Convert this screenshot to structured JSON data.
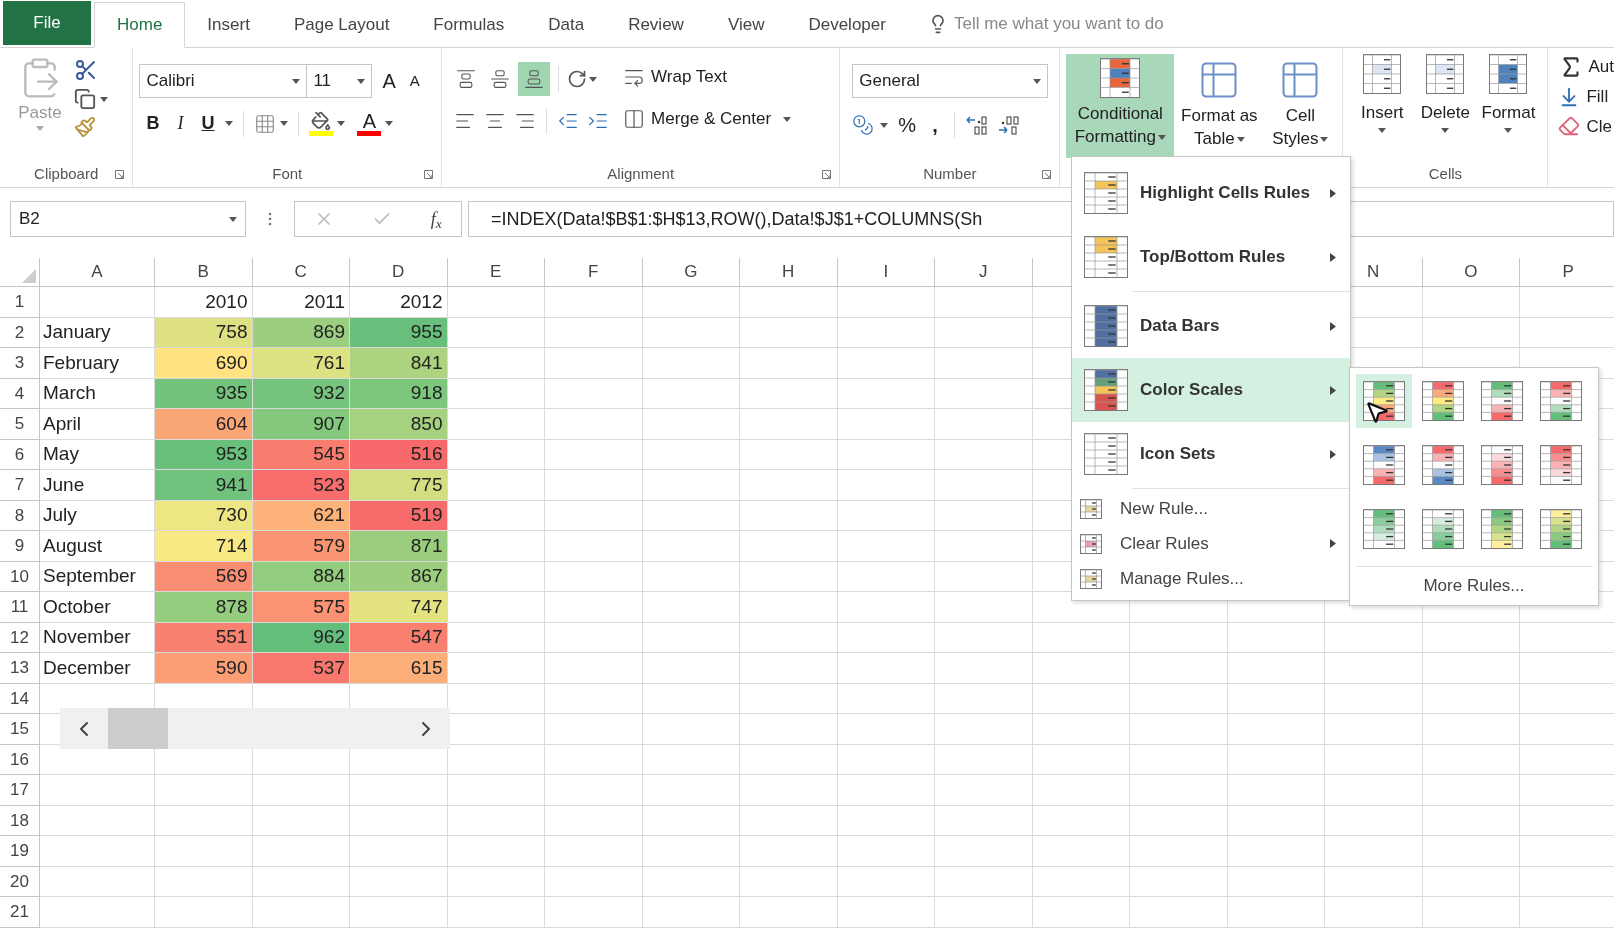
{
  "tabs": [
    {
      "label": "File",
      "kind": "file",
      "selected": false
    },
    {
      "label": "Home",
      "kind": "tab",
      "selected": true
    },
    {
      "label": "Insert",
      "kind": "tab",
      "selected": false
    },
    {
      "label": "Page Layout",
      "kind": "tab",
      "selected": false
    },
    {
      "label": "Formulas",
      "kind": "tab",
      "selected": false
    },
    {
      "label": "Data",
      "kind": "tab",
      "selected": false
    },
    {
      "label": "Review",
      "kind": "tab",
      "selected": false
    },
    {
      "label": "View",
      "kind": "tab",
      "selected": false
    },
    {
      "label": "Developer",
      "kind": "tab",
      "selected": false
    }
  ],
  "tell_me": {
    "placeholder": "Tell me what you want to do"
  },
  "ribbon": {
    "clipboard": {
      "paste": "Paste",
      "label": "Clipboard"
    },
    "font": {
      "name": "Calibri",
      "size": "11",
      "grow": "A",
      "shrink": "A",
      "bold": "B",
      "italic": "I",
      "underline": "U",
      "color_letter": "A",
      "label": "Font"
    },
    "alignment": {
      "vertical": [
        {
          "selected": false
        },
        {
          "selected": false
        },
        {
          "selected": true
        }
      ],
      "wrap": "Wrap Text",
      "merge": "Merge & Center",
      "label": "Alignment"
    },
    "number": {
      "format": "General",
      "percent": "%",
      "comma": ",",
      "label": "Number"
    },
    "styles": {
      "conditional": {
        "label": "Conditional Formatting",
        "expanded": true
      },
      "table": "Format as Table",
      "cell": "Cell Styles"
    },
    "cells": {
      "insert": "Insert",
      "delete": "Delete",
      "format": "Format",
      "label": "Cells"
    },
    "editing": {
      "autosum": "Aut",
      "fill": "Fill",
      "clear": "Cle"
    }
  },
  "formula_bar": {
    "name_box": "B2",
    "fx": "f$_{x}$",
    "formula": "=INDEX(Data!$B$1:$H$13,ROW(),Data!$J$1+COLUMNS(Sh"
  },
  "column_headers_left": [
    "A",
    "B",
    "C",
    "D",
    "E",
    "F",
    "G",
    "H",
    "I",
    "J"
  ],
  "column_headers_right": [
    "N",
    "O",
    "P"
  ],
  "row_numbers": [
    "1",
    "2",
    "3",
    "4",
    "5",
    "6",
    "7",
    "8",
    "9",
    "10",
    "11",
    "12",
    "13",
    "14",
    "15",
    "16",
    "17",
    "18",
    "19",
    "20",
    "21"
  ],
  "header_row": [
    "2010",
    "2011",
    "2012"
  ],
  "rows": [
    {
      "month": "January",
      "cells": [
        {
          "value": "758",
          "color": "#dde182"
        },
        {
          "value": "869",
          "color": "#9bce7e"
        },
        {
          "value": "955",
          "color": "#67bf7b"
        }
      ]
    },
    {
      "month": "February",
      "cells": [
        {
          "value": "690",
          "color": "#ffe382"
        },
        {
          "value": "761",
          "color": "#dce182"
        },
        {
          "value": "841",
          "color": "#acd37f"
        }
      ]
    },
    {
      "month": "March",
      "cells": [
        {
          "value": "935",
          "color": "#73c37c"
        },
        {
          "value": "932",
          "color": "#75c37c"
        },
        {
          "value": "918",
          "color": "#7dc67d"
        }
      ]
    },
    {
      "month": "April",
      "cells": [
        {
          "value": "604",
          "color": "#fba677"
        },
        {
          "value": "907",
          "color": "#84c87d"
        },
        {
          "value": "850",
          "color": "#a6d17f"
        }
      ]
    },
    {
      "month": "May",
      "cells": [
        {
          "value": "953",
          "color": "#68c07b"
        },
        {
          "value": "545",
          "color": "#f97d6f"
        },
        {
          "value": "516",
          "color": "#f8696b"
        }
      ]
    },
    {
      "month": "June",
      "cells": [
        {
          "value": "941",
          "color": "#70c27c"
        },
        {
          "value": "523",
          "color": "#f86e6c"
        },
        {
          "value": "775",
          "color": "#d3de81"
        }
      ]
    },
    {
      "month": "July",
      "cells": [
        {
          "value": "730",
          "color": "#eee683"
        },
        {
          "value": "621",
          "color": "#fcb279"
        },
        {
          "value": "519",
          "color": "#f86b6b"
        }
      ]
    },
    {
      "month": "August",
      "cells": [
        {
          "value": "714",
          "color": "#f8e984"
        },
        {
          "value": "579",
          "color": "#fa9573"
        },
        {
          "value": "871",
          "color": "#9ace7e"
        }
      ]
    },
    {
      "month": "September",
      "cells": [
        {
          "value": "569",
          "color": "#fa8e72"
        },
        {
          "value": "884",
          "color": "#92cc7e"
        },
        {
          "value": "867",
          "color": "#9cce7e"
        }
      ]
    },
    {
      "month": "October",
      "cells": [
        {
          "value": "878",
          "color": "#95cd7e"
        },
        {
          "value": "575",
          "color": "#fa9273"
        },
        {
          "value": "747",
          "color": "#e4e382"
        }
      ]
    },
    {
      "month": "November",
      "cells": [
        {
          "value": "551",
          "color": "#f98170"
        },
        {
          "value": "962",
          "color": "#63be7b"
        },
        {
          "value": "547",
          "color": "#f97f6f"
        }
      ]
    },
    {
      "month": "December",
      "cells": [
        {
          "value": "590",
          "color": "#fb9d75"
        },
        {
          "value": "537",
          "color": "#f9786e"
        },
        {
          "value": "615",
          "color": "#fcae78"
        }
      ]
    }
  ],
  "cf_menu": {
    "items": [
      {
        "kind": "big",
        "label": "Highlight Cells Rules",
        "submenu": true,
        "selected": false
      },
      {
        "kind": "big",
        "label": "Top/Bottom Rules",
        "submenu": true,
        "selected": false
      },
      {
        "kind": "separator"
      },
      {
        "kind": "big",
        "label": "Data Bars",
        "submenu": true,
        "selected": false
      },
      {
        "kind": "big",
        "label": "Color Scales",
        "submenu": true,
        "selected": true
      },
      {
        "kind": "big",
        "label": "Icon Sets",
        "submenu": true,
        "selected": false
      },
      {
        "kind": "separator"
      },
      {
        "kind": "small",
        "label": "New Rule...",
        "submenu": false,
        "selected": false
      },
      {
        "kind": "small",
        "label": "Clear Rules",
        "submenu": true,
        "selected": false
      },
      {
        "kind": "small",
        "label": "Manage Rules...",
        "submenu": false,
        "selected": false
      }
    ]
  },
  "color_scales": {
    "swatches": [
      {
        "selected": true
      },
      {
        "selected": false
      },
      {
        "selected": false
      },
      {
        "selected": false
      },
      {
        "selected": false
      },
      {
        "selected": false
      },
      {
        "selected": false
      },
      {
        "selected": false
      },
      {
        "selected": false
      },
      {
        "selected": false
      },
      {
        "selected": false
      },
      {
        "selected": false
      }
    ],
    "more": "More Rules..."
  }
}
